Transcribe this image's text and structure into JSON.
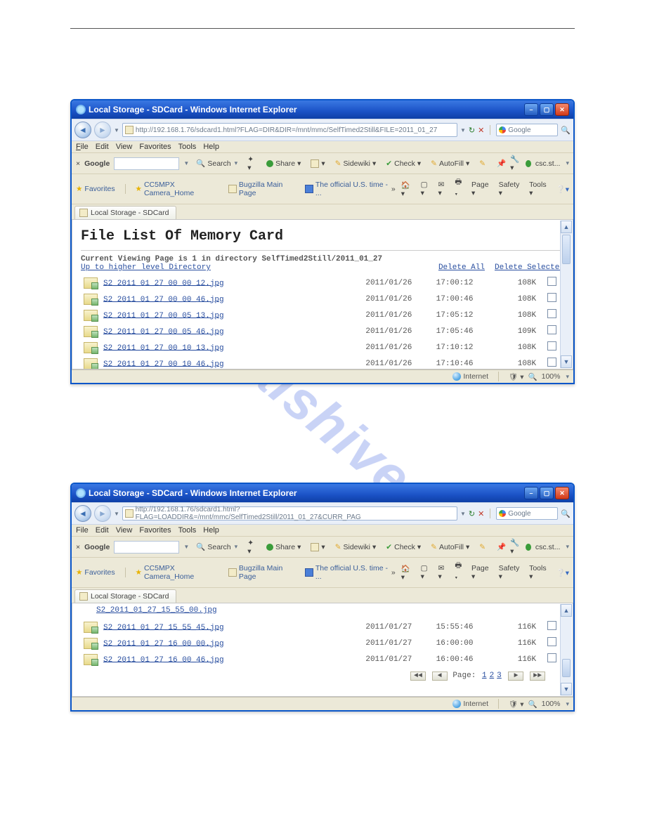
{
  "watermark": "manualshive.com",
  "win1": {
    "title": "Local Storage - SDCard - Windows Internet Explorer",
    "url": "http://192.168.1.76/sdcard1.html?FLAG=DIR&DIR=/mnt/mmc/SelfTimed2Still&FILE=2011_01_27",
    "search_engine": "Google",
    "menu": {
      "file": "File",
      "edit": "Edit",
      "view": "View",
      "fav": "Favorites",
      "tools": "Tools",
      "help": "Help"
    },
    "gtb": {
      "brand": "Google",
      "close": "×",
      "search": "Search",
      "share": "Share",
      "sidewiki": "Sidewiki",
      "check": "Check",
      "autofill": "AutoFill",
      "ext": "csc.st..."
    },
    "fav": {
      "label": "Favorites",
      "l1": "CC5MPX Camera_Home",
      "l2": "Bugzilla Main Page",
      "l3": "The official U.S. time - ...",
      "page": "Page",
      "safety": "Safety",
      "tools": "Tools"
    },
    "tab": "Local Storage - SDCard",
    "heading": "File List Of Memory Card",
    "subhead": "Current Viewing Page is 1 in directory SelfTimed2Still/2011_01_27",
    "uplink": "Up to higher level Directory",
    "delall": "Delete All",
    "delsel": "Delete Selected",
    "rows": [
      {
        "name": "S2_2011_01_27_00_00_12.jpg",
        "date": "2011/01/26",
        "time": "17:00:12",
        "size": "108K"
      },
      {
        "name": "S2_2011_01_27_00_00_46.jpg",
        "date": "2011/01/26",
        "time": "17:00:46",
        "size": "108K"
      },
      {
        "name": "S2_2011_01_27_00_05_13.jpg",
        "date": "2011/01/26",
        "time": "17:05:12",
        "size": "108K"
      },
      {
        "name": "S2_2011_01_27_00_05_46.jpg",
        "date": "2011/01/26",
        "time": "17:05:46",
        "size": "109K"
      },
      {
        "name": "S2_2011_01_27_00_10_13.jpg",
        "date": "2011/01/26",
        "time": "17:10:12",
        "size": "108K"
      },
      {
        "name": "S2_2011_01_27_00_10_46.jpg",
        "date": "2011/01/26",
        "time": "17:10:46",
        "size": "108K"
      }
    ],
    "status": {
      "zone": "Internet",
      "zoom": "100%"
    }
  },
  "win2": {
    "title": "Local Storage - SDCard - Windows Internet Explorer",
    "url": "http://192.168.1.76/sdcard1.html?FLAG=LOADDIR&=/mnt/mmc/SelfTimed2Still/2011_01_27&CURR_PAG",
    "search_engine": "Google",
    "tab": "Local Storage - SDCard",
    "toprow": "S2_2011_01_27_15_55_00.jpg",
    "rows": [
      {
        "name": "S2_2011_01_27_15_55_45.jpg",
        "date": "2011/01/27",
        "time": "15:55:46",
        "size": "116K"
      },
      {
        "name": "S2_2011_01_27_16_00_00.jpg",
        "date": "2011/01/27",
        "time": "16:00:00",
        "size": "116K"
      },
      {
        "name": "S2_2011_01_27_16_00_46.jpg",
        "date": "2011/01/27",
        "time": "16:00:46",
        "size": "116K"
      }
    ],
    "pager": {
      "label": "Page:",
      "pages": [
        "1",
        "2",
        "3"
      ]
    },
    "status": {
      "zone": "Internet",
      "zoom": "100%"
    }
  }
}
